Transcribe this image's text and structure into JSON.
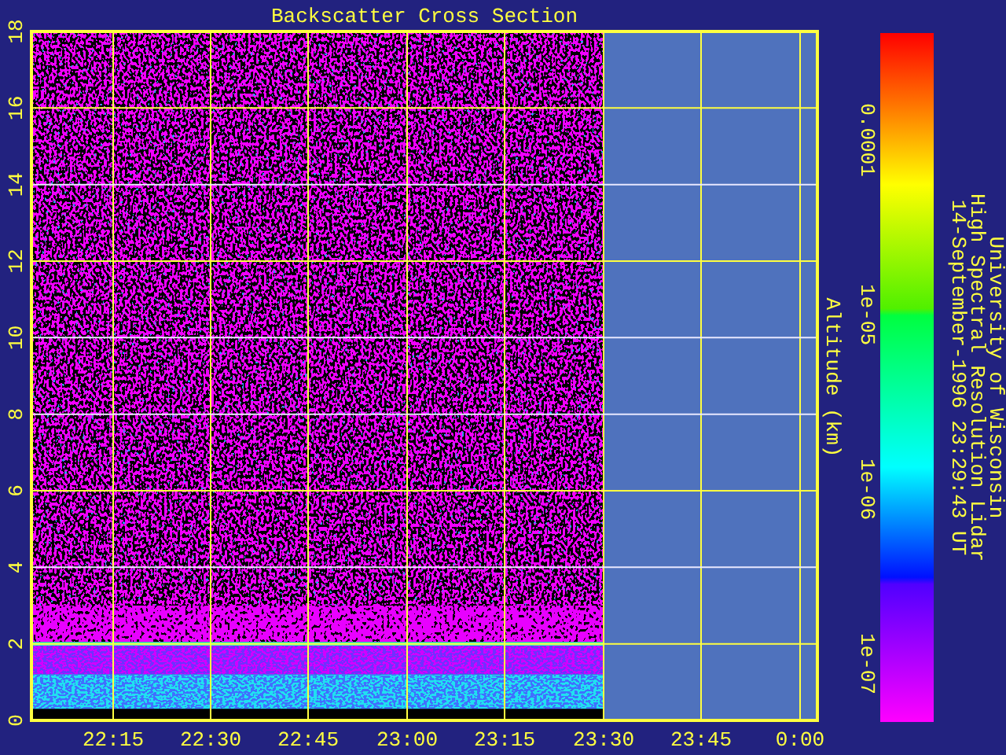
{
  "title": "Backscatter Cross Section",
  "y_axis": {
    "label": "Altitude (km)",
    "ticks": [
      "0",
      "2",
      "4",
      "6",
      "8",
      "10",
      "12",
      "14",
      "16",
      "18"
    ]
  },
  "x_axis": {
    "ticks": [
      "22:15",
      "22:30",
      "22:45",
      "23:00",
      "23:15",
      "23:30",
      "23:45",
      "0:00"
    ]
  },
  "colorbar": {
    "ticks": [
      "0.0001",
      "1e-05",
      "1e-06",
      "1e-07"
    ]
  },
  "credit": [
    "University of Wisconsin",
    "High Spectral Resolution Lidar",
    "14-September-1996 23:29:43 UT"
  ]
}
